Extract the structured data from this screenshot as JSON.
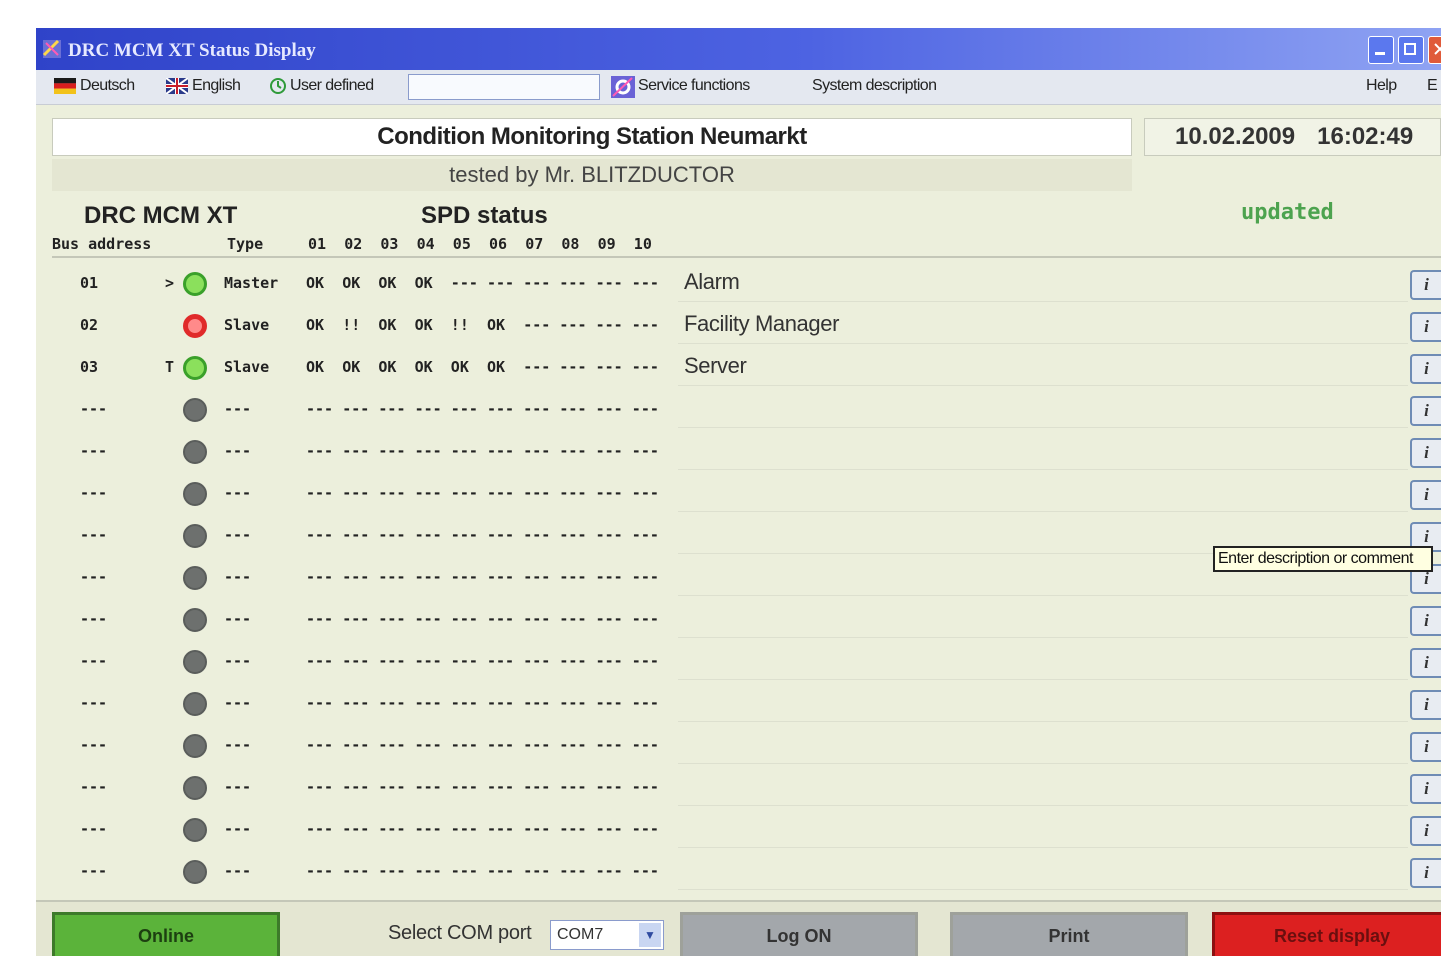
{
  "window": {
    "title": "DRC MCM XT Status Display",
    "colors": {
      "titlebar": "#3447cf",
      "online": "#5bb33a",
      "reset": "#dc2020",
      "updated": "#4da34f"
    }
  },
  "menu": {
    "deutsch": "Deutsch",
    "english": "English",
    "user_defined": "User defined",
    "user_defined_value": "",
    "service_functions": "Service functions",
    "system_description": "System description",
    "help": "Help",
    "exit": "E"
  },
  "header": {
    "station_title": "Condition Monitoring Station Neumarkt",
    "date": "10.02.2009",
    "time": "16:02:49",
    "tested_by": "tested by Mr. BLITZDUCTOR",
    "device_label": "DRC MCM XT",
    "spd_label": "SPD status",
    "updated": "updated"
  },
  "columns": {
    "bus_address": "Bus address",
    "type": "Type",
    "spd": [
      "01",
      "02",
      "03",
      "04",
      "05",
      "06",
      "07",
      "08",
      "09",
      "10"
    ]
  },
  "rows": [
    {
      "addr": "01",
      "marker": ">",
      "led": "green",
      "type": "Master",
      "spd": [
        "OK",
        "OK",
        "OK",
        "OK",
        "---",
        "---",
        "---",
        "---",
        "---",
        "---"
      ],
      "desc": "Alarm"
    },
    {
      "addr": "02",
      "marker": "",
      "led": "red",
      "type": "Slave",
      "spd": [
        "OK",
        "!!",
        "OK",
        "OK",
        "!!",
        "OK",
        "---",
        "---",
        "---",
        "---"
      ],
      "desc": "Facility Manager"
    },
    {
      "addr": "03",
      "marker": "T",
      "led": "green",
      "type": "Slave",
      "spd": [
        "OK",
        "OK",
        "OK",
        "OK",
        "OK",
        "OK",
        "---",
        "---",
        "---",
        "---"
      ],
      "desc": "Server"
    },
    {
      "addr": "---",
      "marker": "",
      "led": "gray",
      "type": "---",
      "spd": [
        "---",
        "---",
        "---",
        "---",
        "---",
        "---",
        "---",
        "---",
        "---",
        "---"
      ],
      "desc": ""
    },
    {
      "addr": "---",
      "marker": "",
      "led": "gray",
      "type": "---",
      "spd": [
        "---",
        "---",
        "---",
        "---",
        "---",
        "---",
        "---",
        "---",
        "---",
        "---"
      ],
      "desc": ""
    },
    {
      "addr": "---",
      "marker": "",
      "led": "gray",
      "type": "---",
      "spd": [
        "---",
        "---",
        "---",
        "---",
        "---",
        "---",
        "---",
        "---",
        "---",
        "---"
      ],
      "desc": ""
    },
    {
      "addr": "---",
      "marker": "",
      "led": "gray",
      "type": "---",
      "spd": [
        "---",
        "---",
        "---",
        "---",
        "---",
        "---",
        "---",
        "---",
        "---",
        "---"
      ],
      "desc": ""
    },
    {
      "addr": "---",
      "marker": "",
      "led": "gray",
      "type": "---",
      "spd": [
        "---",
        "---",
        "---",
        "---",
        "---",
        "---",
        "---",
        "---",
        "---",
        "---"
      ],
      "desc": ""
    },
    {
      "addr": "---",
      "marker": "",
      "led": "gray",
      "type": "---",
      "spd": [
        "---",
        "---",
        "---",
        "---",
        "---",
        "---",
        "---",
        "---",
        "---",
        "---"
      ],
      "desc": ""
    },
    {
      "addr": "---",
      "marker": "",
      "led": "gray",
      "type": "---",
      "spd": [
        "---",
        "---",
        "---",
        "---",
        "---",
        "---",
        "---",
        "---",
        "---",
        "---"
      ],
      "desc": ""
    },
    {
      "addr": "---",
      "marker": "",
      "led": "gray",
      "type": "---",
      "spd": [
        "---",
        "---",
        "---",
        "---",
        "---",
        "---",
        "---",
        "---",
        "---",
        "---"
      ],
      "desc": ""
    },
    {
      "addr": "---",
      "marker": "",
      "led": "gray",
      "type": "---",
      "spd": [
        "---",
        "---",
        "---",
        "---",
        "---",
        "---",
        "---",
        "---",
        "---",
        "---"
      ],
      "desc": ""
    },
    {
      "addr": "---",
      "marker": "",
      "led": "gray",
      "type": "---",
      "spd": [
        "---",
        "---",
        "---",
        "---",
        "---",
        "---",
        "---",
        "---",
        "---",
        "---"
      ],
      "desc": ""
    },
    {
      "addr": "---",
      "marker": "",
      "led": "gray",
      "type": "---",
      "spd": [
        "---",
        "---",
        "---",
        "---",
        "---",
        "---",
        "---",
        "---",
        "---",
        "---"
      ],
      "desc": ""
    },
    {
      "addr": "---",
      "marker": "",
      "led": "gray",
      "type": "---",
      "spd": [
        "---",
        "---",
        "---",
        "---",
        "---",
        "---",
        "---",
        "---",
        "---",
        "---"
      ],
      "desc": ""
    }
  ],
  "info_button_label": "i",
  "tooltip": "Enter description or comment",
  "footer": {
    "online": "Online",
    "com_label": "Select COM port",
    "com_value": "COM7",
    "log_on": "Log ON",
    "print": "Print",
    "reset": "Reset display"
  }
}
